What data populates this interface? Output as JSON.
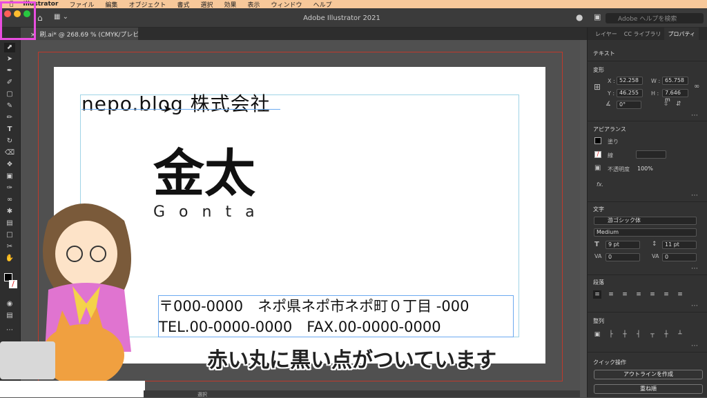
{
  "menubar": {
    "items": [
      "Illustrator",
      "ファイル",
      "編集",
      "オブジェクト",
      "書式",
      "選択",
      "効果",
      "表示",
      "ウィンドウ",
      "ヘルプ"
    ]
  },
  "app": {
    "title": "Adobe Illustrator 2021",
    "help_placeholder": "Adobe ヘルプを検索"
  },
  "document_tab": {
    "label": "刷.ai* @ 268.69 % (CMYK/プレビュー)"
  },
  "artboard": {
    "company": "nepo.blog 株式会社",
    "name": "金太",
    "romaji": "Gonta",
    "address": "〒000-0000　ネポ県ネポ市ネポ町０丁目 -000",
    "tel": "TEL.00-0000-0000　FAX.00-0000-0000"
  },
  "caption": "赤い丸に黒い点がついています",
  "statusbar": {
    "tool": "選択"
  },
  "panel": {
    "tabs": [
      "レイヤー",
      "CC ライブラリ",
      "プロパティ"
    ],
    "section_text": "テキスト",
    "transform": {
      "title": "変形",
      "x_label": "X :",
      "x": "52.258",
      "w_label": "W :",
      "w": "65.758",
      "y_label": "Y :",
      "y": "46.255",
      "h_label": "H :",
      "h": "7.646 m",
      "angle": "0°"
    },
    "appearance": {
      "title": "アピアランス",
      "fill": "塗り",
      "stroke": "線",
      "opacity_label": "不透明度",
      "opacity": "100%",
      "fx": "fx."
    },
    "character": {
      "title": "文字",
      "font": "游ゴシック体",
      "style": "Medium",
      "size": "9 pt",
      "leading": "11 pt",
      "kerning": "0",
      "tracking": "0"
    },
    "paragraph": {
      "title": "段落"
    },
    "align": {
      "title": "整列"
    },
    "quick": {
      "title": "クイック操作",
      "outline_button": "アウトラインを作成",
      "arrange_button": "重ね順"
    }
  },
  "colors": {
    "menubar": "#f7c89a",
    "highlight": "#e94ee0",
    "caption_text": "#222222",
    "bleed": "#c0392b"
  }
}
